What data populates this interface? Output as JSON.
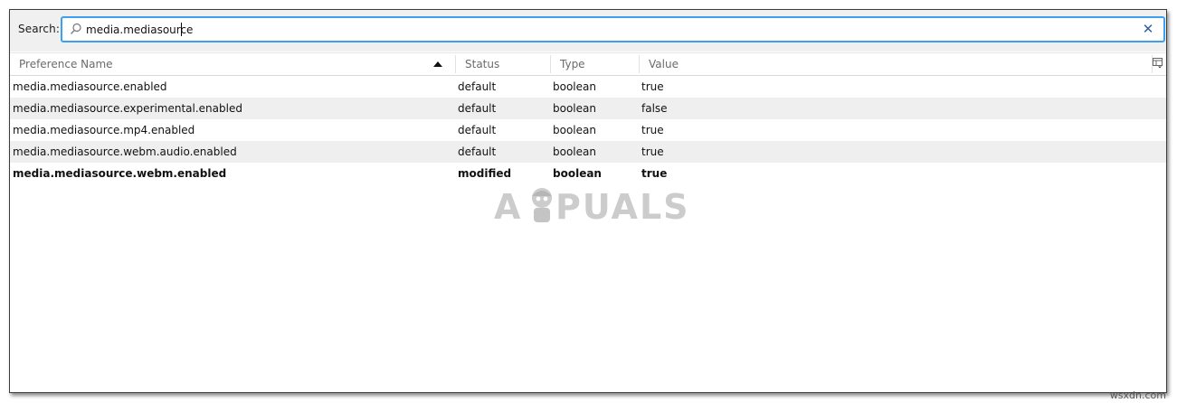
{
  "search": {
    "label": "Search:",
    "value": "media.mediasource",
    "clear_icon": "close-icon",
    "search_icon": "search-icon"
  },
  "columns": {
    "name": "Preference Name",
    "status": "Status",
    "type": "Type",
    "value": "Value",
    "sort_icon": "sort-ascending-icon",
    "picker_icon": "column-picker-icon"
  },
  "rows": [
    {
      "name": "media.mediasource.enabled",
      "status": "default",
      "type": "boolean",
      "value": "true"
    },
    {
      "name": "media.mediasource.experimental.enabled",
      "status": "default",
      "type": "boolean",
      "value": "false"
    },
    {
      "name": "media.mediasource.mp4.enabled",
      "status": "default",
      "type": "boolean",
      "value": "true"
    },
    {
      "name": "media.mediasource.webm.audio.enabled",
      "status": "default",
      "type": "boolean",
      "value": "true"
    },
    {
      "name": "media.mediasource.webm.enabled",
      "status": "modified",
      "type": "boolean",
      "value": "true"
    }
  ],
  "watermark": {
    "first": "A",
    "rest": "PUALS"
  },
  "site_tag": "wsxdn.com",
  "colors": {
    "search_focus_border": "#3c9ff0",
    "alt_row": "#efefef",
    "toolbar_bg": "#f0f0f0"
  }
}
